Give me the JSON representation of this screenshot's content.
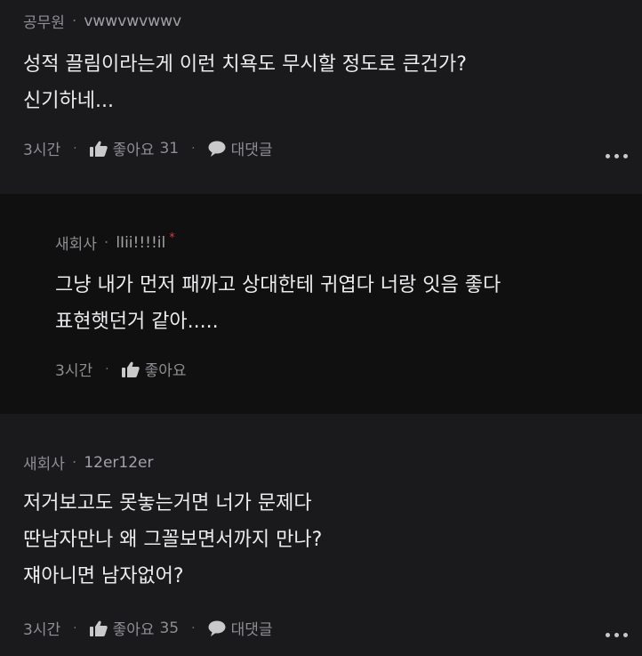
{
  "comments": [
    {
      "author": "공무원",
      "user_id": "vwwvwvwwv",
      "lines": [
        "성적 끌림이라는게 이런 치욕도 무시할 정도로 큰건가?",
        "신기하네..."
      ],
      "time": "3시간",
      "like_label": "좋아요",
      "like_count": "31",
      "reply_label": "대댓글"
    },
    {
      "author": "새회사",
      "user_id": "lIii!!!!il",
      "badge": "*",
      "lines": [
        "그냥 내가 먼저 패까고 상대한테 귀엽다 너랑 잇음 좋다",
        "표현햇던거 같아....."
      ],
      "time": "3시간",
      "like_label": "좋아요"
    },
    {
      "author": "새회사",
      "user_id": "12er12er",
      "lines": [
        "저거보고도 못놓는거면 너가 문제다",
        "딴남자만나 왜 그꼴보면서까지 만나?",
        "쟤아니면 남자없어?"
      ],
      "time": "3시간",
      "like_label": "좋아요",
      "like_count": "35",
      "reply_label": "대댓글"
    }
  ],
  "separator": "·",
  "icons": {
    "like": "thumbs-up-icon",
    "reply": "speech-bubble-icon",
    "more": "more-dots-icon"
  },
  "colors": {
    "background": "#1a1a1c",
    "reply_background": "#101011",
    "badge": "#d23b3b"
  }
}
